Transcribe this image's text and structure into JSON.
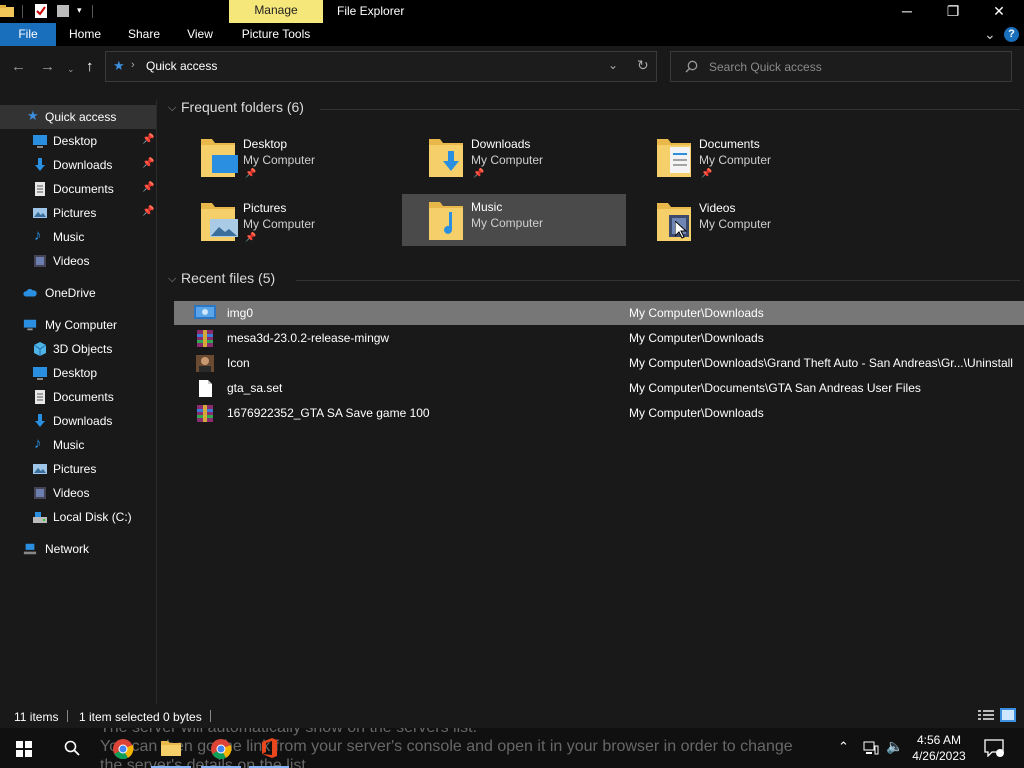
{
  "titlebar": {
    "manage_label": "Manage",
    "app_title": "File Explorer",
    "min_glyph": "─",
    "max_glyph": "❐",
    "close_glyph": "✕"
  },
  "ribbon": {
    "tabs": [
      "File",
      "Home",
      "Share",
      "View",
      "Picture Tools"
    ],
    "expand_glyph": "⌄",
    "help_glyph": "?"
  },
  "address": {
    "path": "Quick access",
    "search_placeholder": "Search Quick access"
  },
  "sidebar": {
    "items": [
      {
        "label": "Quick access",
        "icon": "star-icon",
        "pinned": false
      },
      {
        "label": "Desktop",
        "icon": "desktop-icon",
        "pinned": true
      },
      {
        "label": "Downloads",
        "icon": "download-icon",
        "pinned": true
      },
      {
        "label": "Documents",
        "icon": "document-icon",
        "pinned": true
      },
      {
        "label": "Pictures",
        "icon": "pictures-icon",
        "pinned": true
      },
      {
        "label": "Music",
        "icon": "music-icon",
        "pinned": false
      },
      {
        "label": "Videos",
        "icon": "videos-icon",
        "pinned": false
      },
      {
        "label": "OneDrive",
        "icon": "cloud-icon",
        "pinned": false
      },
      {
        "label": "My Computer",
        "icon": "computer-icon",
        "pinned": false
      },
      {
        "label": "3D Objects",
        "icon": "cube-icon",
        "pinned": false
      },
      {
        "label": "Desktop",
        "icon": "desktop-icon",
        "pinned": false
      },
      {
        "label": "Documents",
        "icon": "document-icon",
        "pinned": false
      },
      {
        "label": "Downloads",
        "icon": "download-icon",
        "pinned": false
      },
      {
        "label": "Music",
        "icon": "music-icon",
        "pinned": false
      },
      {
        "label": "Pictures",
        "icon": "pictures-icon",
        "pinned": false
      },
      {
        "label": "Videos",
        "icon": "videos-icon",
        "pinned": false
      },
      {
        "label": "Local Disk (C:)",
        "icon": "drive-icon",
        "pinned": false
      },
      {
        "label": "Network",
        "icon": "network-icon",
        "pinned": false
      }
    ],
    "pin_glyph": "📌"
  },
  "frequent": {
    "title": "Frequent folders (6)",
    "folders": [
      {
        "name": "Desktop",
        "location": "My Computer",
        "pinned": true,
        "overlay": "desktop-icon"
      },
      {
        "name": "Downloads",
        "location": "My Computer",
        "pinned": true,
        "overlay": "download-icon"
      },
      {
        "name": "Documents",
        "location": "My Computer",
        "pinned": true,
        "overlay": "document-icon"
      },
      {
        "name": "Pictures",
        "location": "My Computer",
        "pinned": true,
        "overlay": "pictures-icon"
      },
      {
        "name": "Music",
        "location": "My Computer",
        "pinned": false,
        "overlay": "music-icon"
      },
      {
        "name": "Videos",
        "location": "My Computer",
        "pinned": false,
        "overlay": "videos-icon"
      }
    ],
    "pin_glyph": "📌"
  },
  "recent": {
    "title": "Recent files (5)",
    "files": [
      {
        "name": "img0",
        "path": "My Computer\\Downloads",
        "icon": "image-file-icon"
      },
      {
        "name": "mesa3d-23.0.2-release-mingw",
        "path": "My Computer\\Downloads",
        "icon": "archive-icon"
      },
      {
        "name": "Icon",
        "path": "My Computer\\Downloads\\Grand Theft Auto - San Andreas\\Gr...\\Uninstall",
        "icon": "icon-file-icon"
      },
      {
        "name": "gta_sa.set",
        "path": "My Computer\\Documents\\GTA San Andreas User Files",
        "icon": "blank-file-icon"
      },
      {
        "name": "1676922352_GTA SA Save game 100",
        "path": "My Computer\\Downloads",
        "icon": "archive-icon"
      }
    ]
  },
  "status": {
    "count": "11 items",
    "selection": "1 item selected  0 bytes"
  },
  "taskbar": {
    "bg_line1": "The server will automatically show on the servers list.",
    "bg_line2": "You can then go the link from your server's console and open it in your browser in order to change",
    "bg_line3": "the server's details on the list.",
    "time": "4:56 AM",
    "date": "4/26/2023"
  },
  "colors": {
    "accent": "#1a6fbd",
    "manage_tab": "#f5e77a",
    "folder": "#f0c659",
    "selection": "#777777"
  }
}
